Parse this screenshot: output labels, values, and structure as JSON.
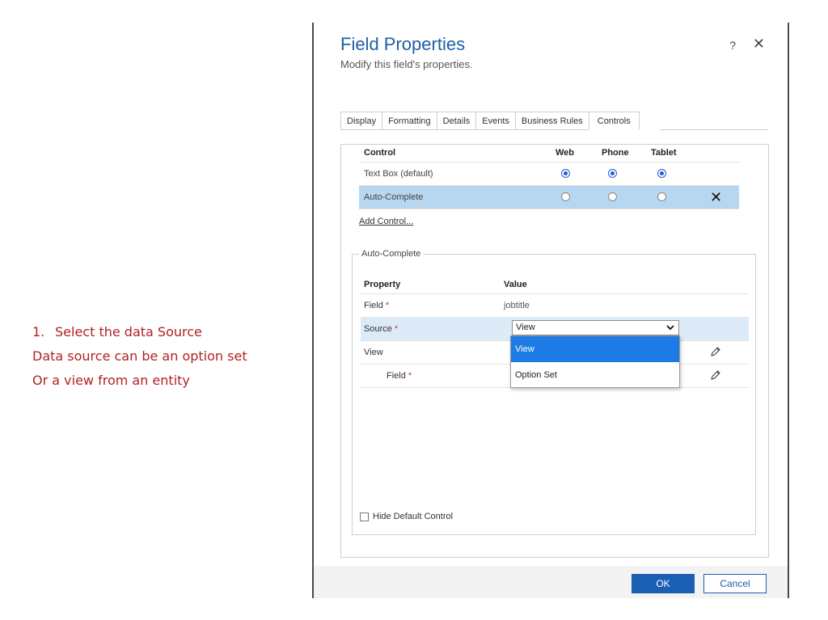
{
  "annotation": {
    "step_number": "1.",
    "step_text": "Select the data Source",
    "line2": "Data source can be an option set",
    "line3": "Or a view from an entity",
    "color": "#b22222"
  },
  "dialog": {
    "title": "Field Properties",
    "subtitle": "Modify this field's properties.",
    "help_label": "?",
    "close_label": "✕"
  },
  "tabs": [
    {
      "label": "Display"
    },
    {
      "label": "Formatting"
    },
    {
      "label": "Details"
    },
    {
      "label": "Events"
    },
    {
      "label": "Business Rules"
    },
    {
      "label": "Controls",
      "active": true
    }
  ],
  "controls_table": {
    "headers": {
      "control": "Control",
      "web": "Web",
      "phone": "Phone",
      "tablet": "Tablet"
    },
    "rows": [
      {
        "name": "Text Box (default)",
        "web": true,
        "phone": true,
        "tablet": true
      },
      {
        "name": "Auto-Complete",
        "web": false,
        "phone": false,
        "tablet": false,
        "selected": true,
        "remove_label": "✕"
      }
    ],
    "add_control_label": "Add Control..."
  },
  "auto_complete": {
    "legend": "Auto-Complete",
    "headers": {
      "property": "Property",
      "value": "Value"
    },
    "rows": [
      {
        "name": "Field",
        "required_mark": "*",
        "value": "jobtitle"
      },
      {
        "name": "Source",
        "required_mark": "*",
        "value": "View"
      },
      {
        "name": "View"
      },
      {
        "name": "Field",
        "required_mark": "*"
      }
    ],
    "dropdown_options": [
      "View",
      "Option Set"
    ],
    "hide_default_label": "Hide Default Control"
  },
  "footer": {
    "ok_label": "OK",
    "cancel_label": "Cancel"
  },
  "colors": {
    "title_blue": "#1f5fa8",
    "selected_row": "#b7d6ef",
    "dropdown_highlight": "#1e7be6",
    "primary_button": "#1a5fb4"
  },
  "icons": {
    "remove_control": "close-icon",
    "edit": "pencil-icon",
    "select_chevron": "chevron-down-icon"
  }
}
